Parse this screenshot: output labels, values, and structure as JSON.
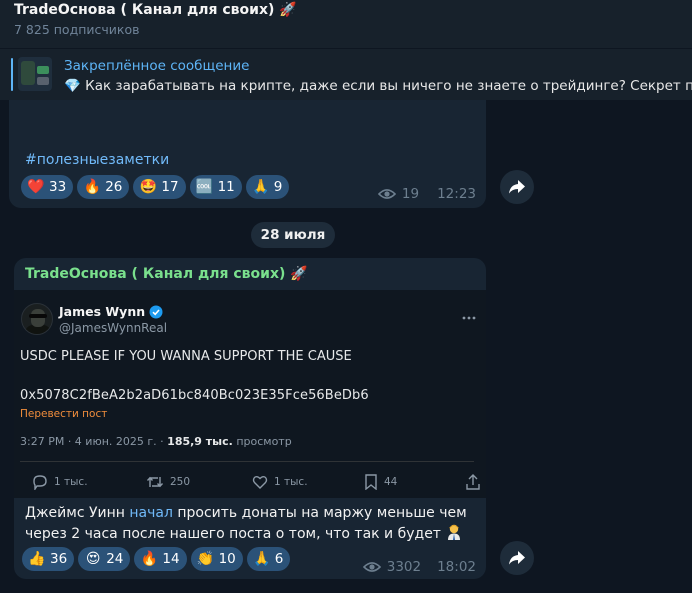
{
  "channel": {
    "title": "TradeОснова ( Канал для своих)",
    "title_emoji": "rocket",
    "subscribers": "7 825 подписчиков"
  },
  "pinned": {
    "label": "Закреплённое сообщение",
    "emoji": "💎",
    "text": "Как зарабатывать на крипте, даже если вы ничего не знаете о трейдинге?  Секрет прос"
  },
  "post1": {
    "hashtag": "#полезныезаметки",
    "reactions": [
      {
        "emoji": "❤️",
        "icon": "heart-icon",
        "count": "33"
      },
      {
        "emoji": "🔥",
        "icon": "fire-icon",
        "count": "26"
      },
      {
        "emoji": "🤩",
        "icon": "star-struck-icon",
        "count": "17"
      },
      {
        "emoji": "🆒",
        "icon": "cool-icon",
        "count": "11"
      },
      {
        "emoji": "🙏",
        "icon": "pray-icon",
        "count": "9"
      }
    ],
    "views": "19",
    "time": "12:23"
  },
  "date_separator": "28 июля",
  "post2": {
    "sender": "TradeОснова ( Канал для своих)",
    "tweet": {
      "author_name": "James Wynn",
      "author_handle": "@JamesWynnReal",
      "line1": "USDC PLEASE IF YOU WANNA SUPPORT THE CAUSE",
      "line2": "0x5078C2fBeA2b2aD61bc840Bc023E35Fce56BeDb6",
      "translate": "Перевести пост",
      "time_date": "3:27 PM · 4 июн. 2025 г. ·",
      "views_count": "185,9 тыс.",
      "views_label": "просмотр",
      "replies": "1 тыс.",
      "retweets": "250",
      "likes": "1 тыс.",
      "bookmarks": "44"
    },
    "text_part1": "Джеймс Уинн ",
    "text_link": "начал",
    "text_part2": " просить донаты на маржу меньше чем через 2 часа после нашего поста о том, что так и будет ",
    "reactions": [
      {
        "emoji": "👍",
        "icon": "thumbs-up-icon",
        "count": "36"
      },
      {
        "emoji": "😍",
        "icon": "heart-eyes-icon",
        "count": "24"
      },
      {
        "emoji": "🔥",
        "icon": "fire-icon",
        "count": "14"
      },
      {
        "emoji": "👏",
        "icon": "clap-icon",
        "count": "10"
      },
      {
        "emoji": "🙏",
        "icon": "pray-icon",
        "count": "6"
      }
    ],
    "views": "3302",
    "time": "18:02"
  },
  "colors": {
    "background": "#0e1621",
    "bubble": "#182533",
    "accent": "#5eb5f7",
    "reaction": "#2b5278",
    "sender": "#7ae08d"
  }
}
